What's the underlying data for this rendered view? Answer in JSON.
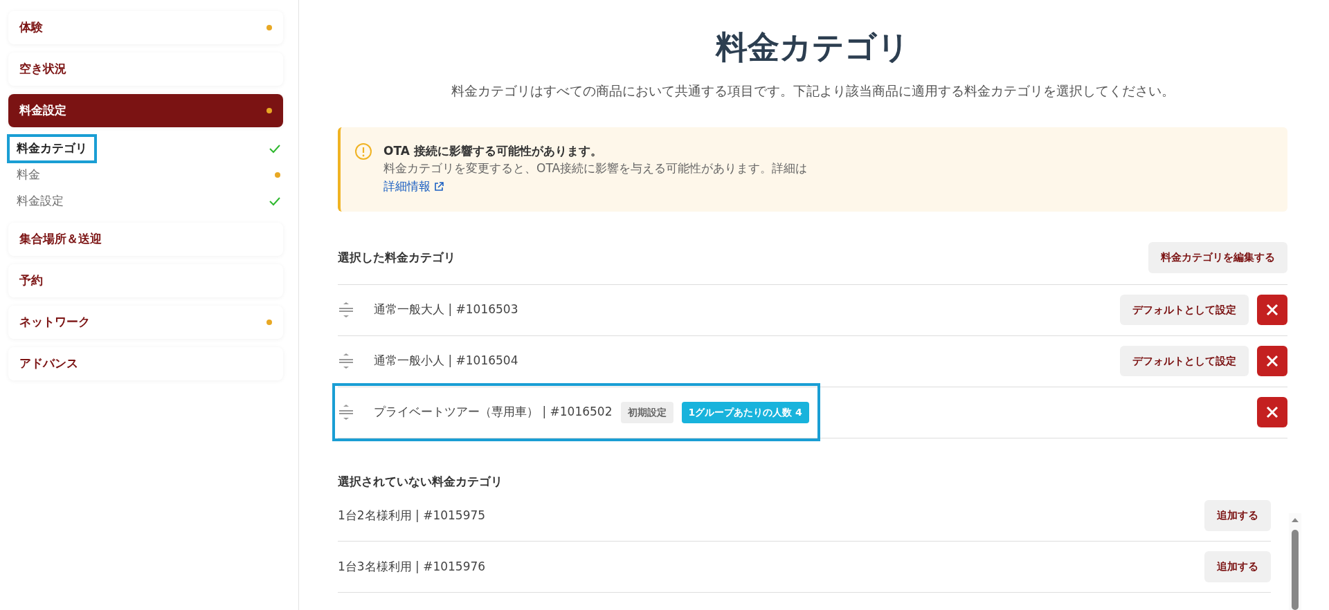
{
  "sidebar": {
    "items": [
      {
        "label": "体験",
        "selected": false,
        "kind": "dot"
      },
      {
        "label": "空き状況",
        "selected": false,
        "kind": "plain"
      },
      {
        "label": "料金設定",
        "selected": true,
        "kind": "dot",
        "children": [
          {
            "label": "料金カテゴリ",
            "selected": true,
            "highlighted": true,
            "kind": "check"
          },
          {
            "label": "料金",
            "selected": false,
            "highlighted": false,
            "kind": "dot"
          },
          {
            "label": "料金設定",
            "selected": false,
            "highlighted": false,
            "kind": "check"
          }
        ]
      },
      {
        "label": "集合場所＆送迎",
        "selected": false,
        "kind": "plain"
      },
      {
        "label": "予約",
        "selected": false,
        "kind": "plain"
      },
      {
        "label": "ネットワーク",
        "selected": false,
        "kind": "dot"
      },
      {
        "label": "アドバンス",
        "selected": false,
        "kind": "plain"
      }
    ]
  },
  "page": {
    "title": "料金カテゴリ",
    "subtitle": "料金カテゴリはすべての商品において共通する項目です。下記より該当商品に適用する料金カテゴリを選択してください。"
  },
  "alert": {
    "title": "OTA 接続に影響する可能性があります。",
    "body": "料金カテゴリを変更すると、OTA接続に影響を与える可能性があります。詳細は",
    "link": "詳細情報"
  },
  "selected_section": {
    "heading": "選択した料金カテゴリ",
    "edit_button": "料金カテゴリを編集する",
    "rows": [
      {
        "name": "通常一般大人 | #1016503",
        "default_button": "デフォルトとして設定",
        "highlighted": false
      },
      {
        "name": "通常一般小人 | #1016504",
        "default_button": "デフォルトとして設定",
        "highlighted": false
      },
      {
        "name": "プライベートツアー（専用車） | #1016502",
        "highlighted": true,
        "tags": [
          {
            "label": "初期設定",
            "kind": "default"
          },
          {
            "label": "1グループあたりの人数 4",
            "kind": "info"
          }
        ]
      }
    ]
  },
  "unselected_section": {
    "heading": "選択されていない料金カテゴリ",
    "rows": [
      {
        "name": "1台2名様利用 | #1015975",
        "add_button": "追加する"
      },
      {
        "name": "1台3名様利用 | #1015976",
        "add_button": "追加する"
      }
    ]
  }
}
